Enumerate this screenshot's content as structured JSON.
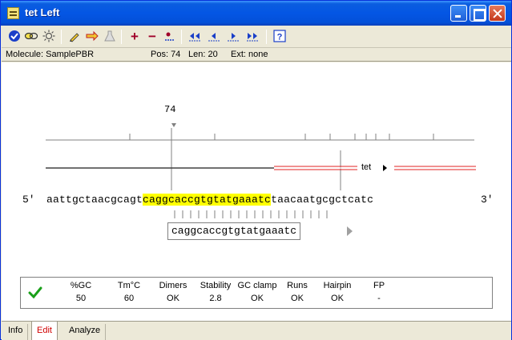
{
  "window": {
    "title": "tet Left"
  },
  "toolbar": {
    "icons": [
      "check-circle",
      "link",
      "sun",
      "pencil",
      "double-arrow",
      "flask",
      "plus",
      "minus",
      "step",
      "first",
      "prev",
      "next",
      "last",
      "help"
    ]
  },
  "info": {
    "molecule": "Molecule: SamplePBR",
    "pos": "Pos: 74",
    "len": "Len: 20",
    "ext": "Ext: none"
  },
  "map": {
    "position_label": "74",
    "feature_label": "tet"
  },
  "sequence": {
    "five_prime": "5'",
    "three_prime": "3'",
    "before": "aattgctaacgcagt",
    "primer": "caggcaccgtgtatgaaatc",
    "after": "taacaatgcgctcatc",
    "primer_box": "caggcaccgtgtatgaaatc"
  },
  "stats": {
    "headers": [
      "%GC",
      "Tm°C",
      "Dimers",
      "Stability",
      "GC clamp",
      "Runs",
      "Hairpin",
      "FP"
    ],
    "values": [
      "50",
      "60",
      "OK",
      "2.8",
      "OK",
      "OK",
      "OK",
      "-"
    ]
  },
  "tabs": [
    {
      "label": "Info"
    },
    {
      "label": "Edit"
    },
    {
      "label": "Analyze"
    }
  ],
  "colors": {
    "highlight": "#ffff00",
    "feature_line": "#e02020",
    "active_tab": "#d00000",
    "check": "#1aa01a"
  }
}
